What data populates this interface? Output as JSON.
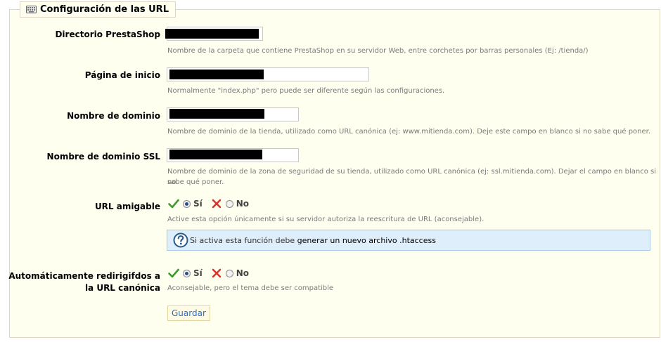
{
  "fieldset": {
    "legend": "Configuración de las URL"
  },
  "fields": {
    "directorio": {
      "label": "Directorio PrestaShop",
      "hint": "Nombre de la carpeta que contiene PrestaShop en su servidor Web, entre corchetes por barras personales (Ej: /tienda/)"
    },
    "pagina": {
      "label": "Página de inicio",
      "hint": "Normalmente \"index.php\" pero puede ser diferente según las configuraciones."
    },
    "dominio": {
      "label": "Nombre de dominio",
      "hint": "Nombre de dominio de la tienda, utilizado como URL canónica (ej: www.mitienda.com). Deje este campo en blanco si no sabe qué poner."
    },
    "dominio_ssl": {
      "label": "Nombre de dominio SSL",
      "hint_line1": "Nombre de dominio de la zona de seguridad de su tienda, utilizado como URL canónica (ej: ssl.mitienda.com). Dejar el campo en blanco si no",
      "hint_line2": "sabe qué poner."
    },
    "url_amigable": {
      "label": "URL amigable",
      "yes": "Sí",
      "no": "No",
      "selected": "Sí",
      "hint": "Active esta opción únicamente si su servidor autoriza la reescritura de URL (aconsejable).",
      "info_prefix": "Si activa esta función debe ",
      "info_link": "generar un nuevo archivo .htaccess"
    },
    "redirigir": {
      "label_line1": "Automáticamente redirigifdos a",
      "label_line2": "la URL canónica",
      "yes": "Sí",
      "no": "No",
      "selected": "Sí",
      "hint": "Aconsejable, pero el tema debe ser compatible"
    }
  },
  "save_label": "Guardar",
  "colors": {
    "panel_bg": "#fffff0",
    "panel_border": "#dfd5c3",
    "info_bg": "#dfeefb",
    "button_text": "#2f6fbf"
  }
}
